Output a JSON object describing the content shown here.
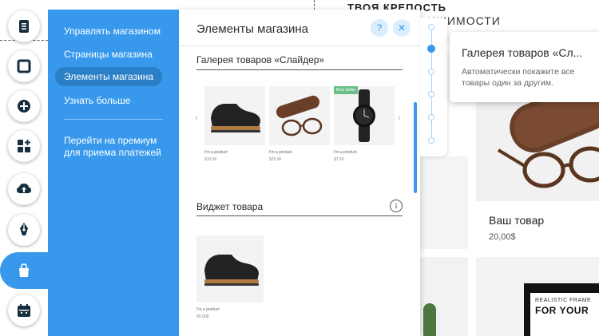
{
  "site": {
    "heading": "ТВОЯ КРЕПОСТЬ",
    "subheading": "ИЖИМОСТИ",
    "product_name": "Ваш товар",
    "product_price": "20,00$",
    "frame_line1": "REALISTIC FRAME",
    "frame_line2": "FOR YOUR"
  },
  "toolbar": {
    "icons": [
      "pages-icon",
      "background-icon",
      "add-icon",
      "apps-icon",
      "upload-icon",
      "blog-icon",
      "store-icon",
      "bookings-icon"
    ]
  },
  "menu": {
    "items": [
      {
        "label": "Управлять магазином"
      },
      {
        "label": "Страницы магазина"
      },
      {
        "label": "Элементы магазина"
      },
      {
        "label": "Узнать больше"
      }
    ],
    "premium": "Перейти на премиум для приема платежей"
  },
  "panel": {
    "title": "Элементы магазина",
    "help_label": "?",
    "close_label": "✕",
    "gallery_title": "Галерея товаров «Слайдер»",
    "cards": [
      {
        "name": "I'm a product",
        "price": "$10.00",
        "badge": ""
      },
      {
        "name": "I'm a product",
        "price": "$25.00",
        "badge": ""
      },
      {
        "name": "I'm a product",
        "price": "$7.50",
        "badge": "Best Seller"
      }
    ],
    "widget_title": "Виджет товара",
    "widget": {
      "name": "I'm a product",
      "price": "85.00$"
    }
  },
  "tooltip": {
    "title": "Галерея товаров «Сл...",
    "text": "Автоматически покажите все товары один за другим."
  },
  "colors": {
    "accent": "#3899ec",
    "menu_selected": "#2b7fc7"
  }
}
